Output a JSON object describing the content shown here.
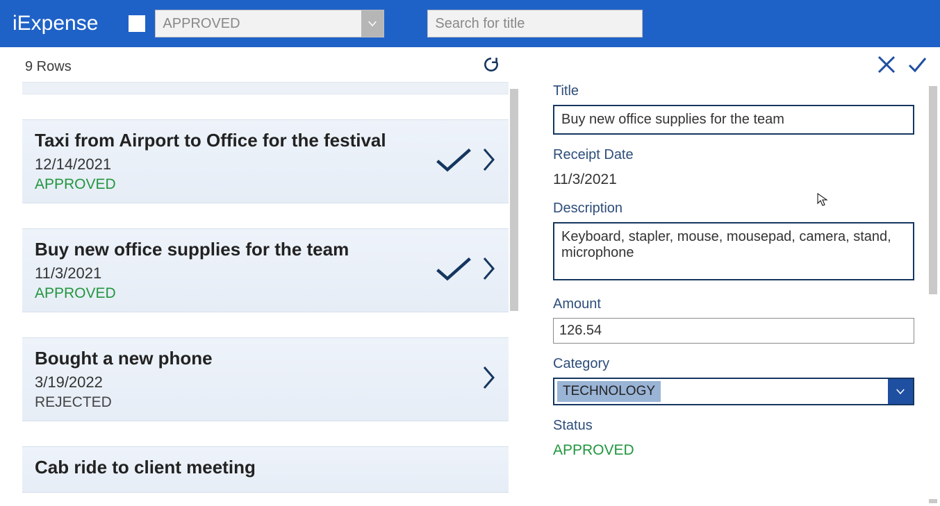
{
  "header": {
    "app_title": "iExpense",
    "filter_value": "APPROVED",
    "search_placeholder": "Search for title"
  },
  "list": {
    "row_count_label": "9 Rows",
    "items": [
      {
        "title": "Taxi from Airport to Office for the festival",
        "date": "12/14/2021",
        "status": "APPROVED",
        "approved": true
      },
      {
        "title": "Buy new office supplies for the team",
        "date": "11/3/2021",
        "status": "APPROVED",
        "approved": true
      },
      {
        "title": "Bought a new phone",
        "date": "3/19/2022",
        "status": "REJECTED",
        "approved": false
      },
      {
        "title": "Cab ride to client meeting",
        "date": "",
        "status": "",
        "approved": true
      }
    ]
  },
  "detail": {
    "labels": {
      "title": "Title",
      "receipt_date": "Receipt Date",
      "description": "Description",
      "amount": "Amount",
      "category": "Category",
      "status": "Status"
    },
    "title": "Buy new office supplies for the team",
    "receipt_date": "11/3/2021",
    "description": "Keyboard, stapler, mouse, mousepad, camera, stand, microphone",
    "amount": "126.54",
    "category": "TECHNOLOGY",
    "status": "APPROVED"
  }
}
